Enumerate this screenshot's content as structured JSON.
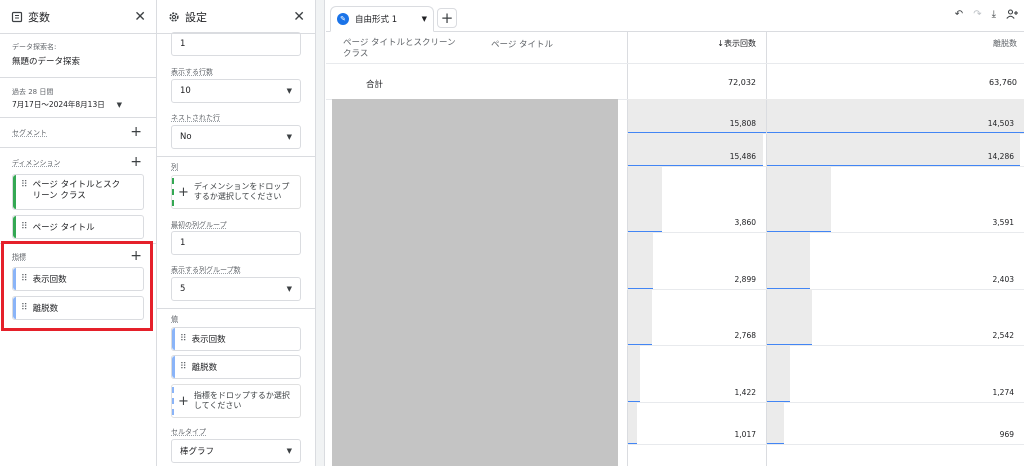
{
  "variables": {
    "title": "変数",
    "exploration_name_label": "データ探索名:",
    "exploration_name": "無題のデータ探索",
    "date_label": "過去 28 日間",
    "date_range": "7月17日～2024年8月13日",
    "segment_label": "セグメント",
    "dimension_label": "ディメンション",
    "dimensions": [
      "ページ タイトルとスク リーン クラス",
      "ページ タイトル"
    ],
    "metric_label": "指標",
    "metrics": [
      "表示回数",
      "離脱数"
    ]
  },
  "settings": {
    "title": "設定",
    "top_value": "1",
    "rows_label": "表示する行数",
    "rows_value": "10",
    "nested_label": "ネストされた行",
    "nested_value": "No",
    "columns_label": "列",
    "column_drop": "ディメンションをドロップするか選択してください",
    "first_col_group_label": "最初の列グループ",
    "first_col_group_value": "1",
    "col_groups_label": "表示する列グループ数",
    "col_groups_value": "5",
    "values_label": "値",
    "values": [
      "表示回数",
      "離脱数"
    ],
    "metric_drop": "指標をドロップするか選択してください",
    "cell_type_label": "セルタイプ",
    "cell_type_value": "棒グラフ"
  },
  "tab": {
    "name": "自由形式 1"
  },
  "table": {
    "col_dim1": "ページ タイトルとスクリーン クラス",
    "col_dim2": "ページ タイトル",
    "col_metric1": "↓表示回数",
    "col_metric2": "離脱数",
    "total_label": "合計",
    "total_views": "72,032",
    "total_exits": "63,760",
    "rows": [
      {
        "views": "15,808",
        "exits": "14,503",
        "views_frac": 1.0,
        "exits_frac": 1.0
      },
      {
        "views": "15,486",
        "exits": "14,286",
        "views_frac": 0.98,
        "exits_frac": 0.985
      },
      {
        "views": "3,860",
        "exits": "3,591",
        "views_frac": 0.244,
        "exits_frac": 0.248
      },
      {
        "views": "2,899",
        "exits": "2,403",
        "views_frac": 0.183,
        "exits_frac": 0.166
      },
      {
        "views": "2,768",
        "exits": "2,542",
        "views_frac": 0.175,
        "exits_frac": 0.175
      },
      {
        "views": "1,422",
        "exits": "1,274",
        "views_frac": 0.09,
        "exits_frac": 0.088
      },
      {
        "views": "1,017",
        "exits": "969",
        "views_frac": 0.064,
        "exits_frac": 0.067
      }
    ]
  },
  "colors": {
    "accent": "#1a73e8",
    "bar_line": "#4285f4",
    "highlight_border": "#e5202a"
  },
  "icons": {
    "variables": "variables-icon",
    "settings": "gear-icon",
    "undo": "undo-icon",
    "redo": "redo-icon",
    "download": "download-icon",
    "share": "share-user-icon"
  }
}
